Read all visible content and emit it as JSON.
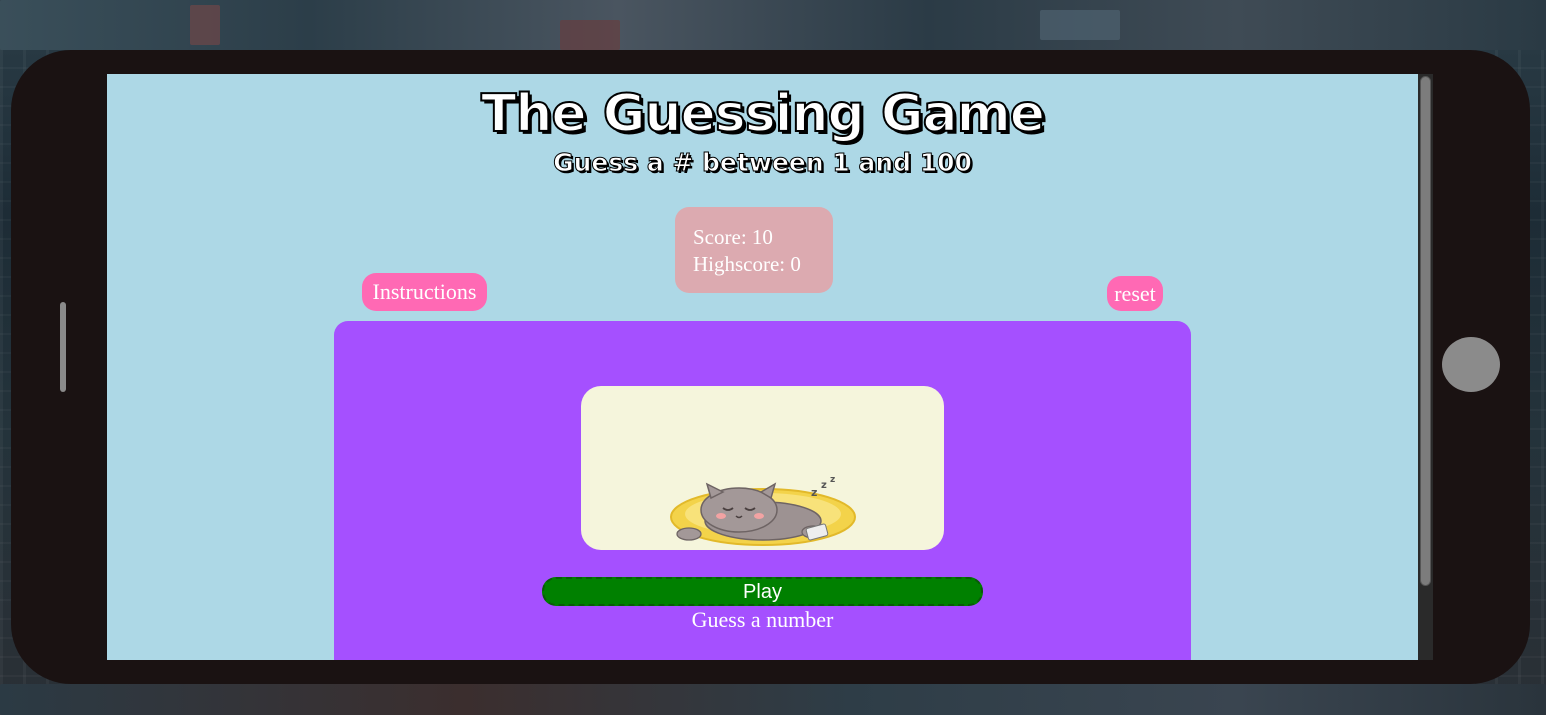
{
  "page": {
    "title": "The Guessing Game",
    "subtitle": "Guess a # between 1 and 100"
  },
  "scoreboard": {
    "score_label": "Score: 10",
    "highscore_label": "Highscore: 0"
  },
  "buttons": {
    "instructions_label": "Instructions",
    "reset_label": "reset",
    "play_label": "Play"
  },
  "game": {
    "status_text": "Guess a number",
    "image_subject": "sleeping-cat-illustration"
  },
  "colors": {
    "screen_background": "#add8e6",
    "game_panel": "#a550ff",
    "score_box": "#dcaab0",
    "pill_button": "#ff69b4",
    "play_button": "#008000",
    "image_card": "#f5f5dc",
    "phone_body": "#1a1212"
  }
}
